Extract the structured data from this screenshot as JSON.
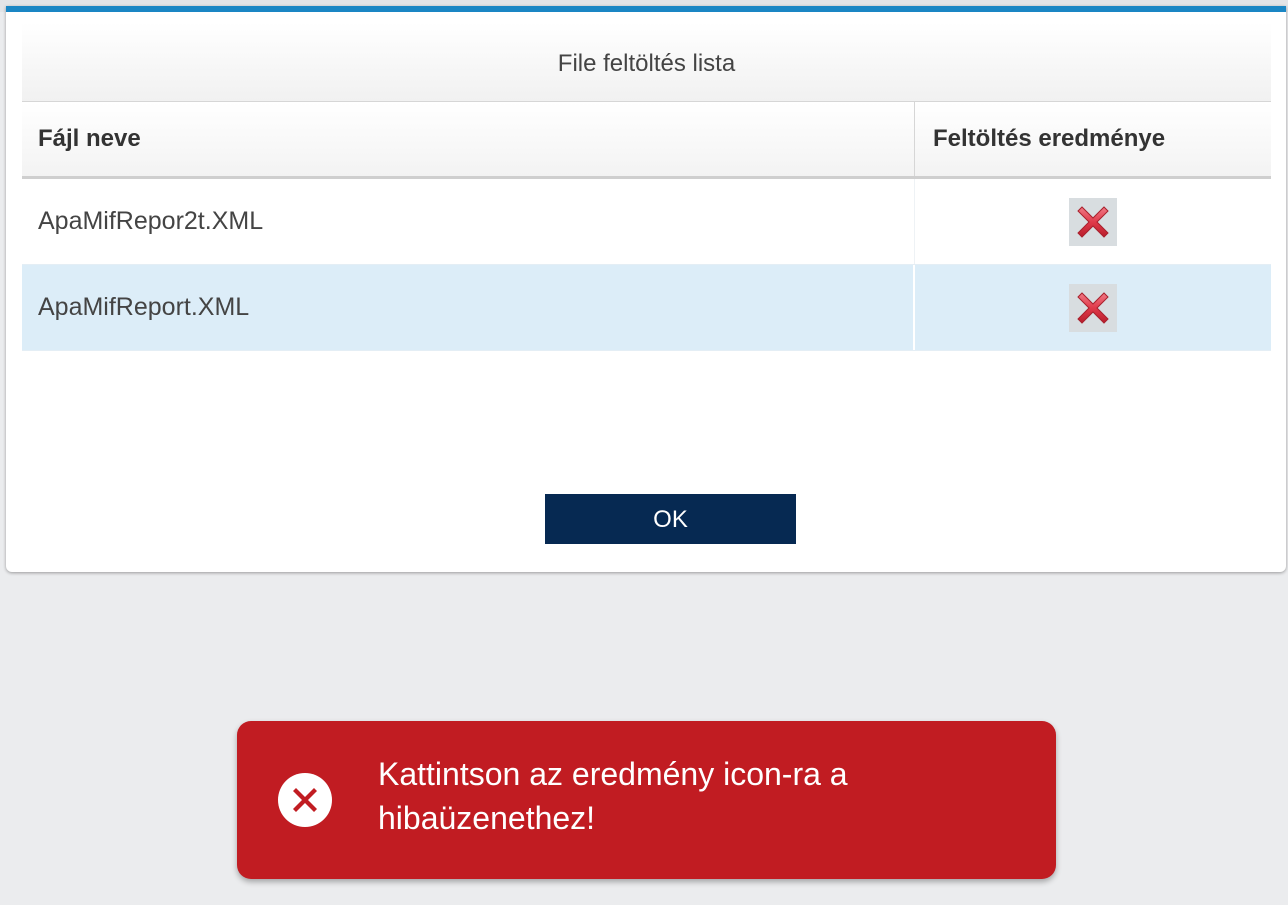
{
  "dialog": {
    "title": "File feltöltés lista",
    "columns": {
      "name": "Fájl neve",
      "result": "Feltöltés eredménye"
    },
    "rows": [
      {
        "file_name": "ApaMifRepor2t.XML",
        "result_icon": "red-x-icon",
        "selected": false
      },
      {
        "file_name": "ApaMifReport.XML",
        "result_icon": "red-x-icon",
        "selected": true
      }
    ],
    "ok_label": "OK"
  },
  "toast": {
    "icon": "error-circle-icon",
    "message": "Kattintson az eredmény icon-ra a hibaüzenethez!"
  },
  "colors": {
    "accent": "#1a86c4",
    "ok_button": "#062952",
    "selected_row": "#dcedf8",
    "toast_bg": "#c11c22"
  }
}
